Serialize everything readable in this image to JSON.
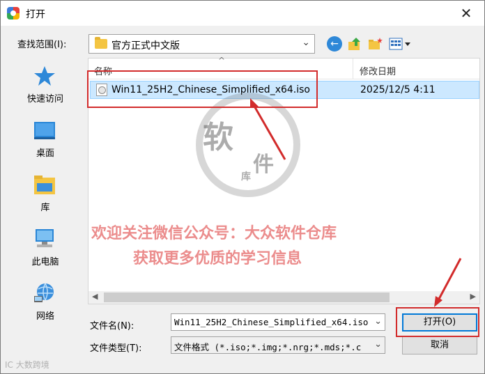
{
  "window": {
    "title": "打开",
    "close_glyph": "✕"
  },
  "look_in": {
    "label": "查找范围(I):",
    "value": "官方正式中文版",
    "chevron": "⌄"
  },
  "toolbar": {
    "back_glyph": "←"
  },
  "places": [
    {
      "label": "快速访问",
      "icon": "star-icon"
    },
    {
      "label": "桌面",
      "icon": "desktop-icon"
    },
    {
      "label": "库",
      "icon": "library-icon"
    },
    {
      "label": "此电脑",
      "icon": "computer-icon"
    },
    {
      "label": "网络",
      "icon": "network-icon"
    }
  ],
  "list": {
    "col_name": "名称",
    "col_date": "修改日期",
    "sort_caret": "^",
    "files": [
      {
        "name": "Win11_25H2_Chinese_Simplified_x64.iso",
        "date": "2025/12/5 4:11"
      }
    ]
  },
  "watermark": {
    "chars": [
      "软",
      "件",
      "库"
    ]
  },
  "promo": {
    "line1": "欢迎关注微信公众号：大众软件仓库",
    "line2": "获取更多优质的学习信息"
  },
  "filename": {
    "label": "文件名(N):",
    "value": "Win11_25H2_Chinese_Simplified_x64.iso",
    "chevron": "⌄"
  },
  "filetype": {
    "label": "文件类型(T):",
    "value": "文件格式 (*.iso;*.img;*.nrg;*.mds;*.c",
    "chevron": "⌄"
  },
  "buttons": {
    "open": "打开(O)",
    "cancel": "取消"
  },
  "corner_watermark": "IC 大数跨境",
  "colors": {
    "selection": "#cce8ff",
    "annotation_red": "#d22b2b",
    "accent": "#0078d7"
  }
}
